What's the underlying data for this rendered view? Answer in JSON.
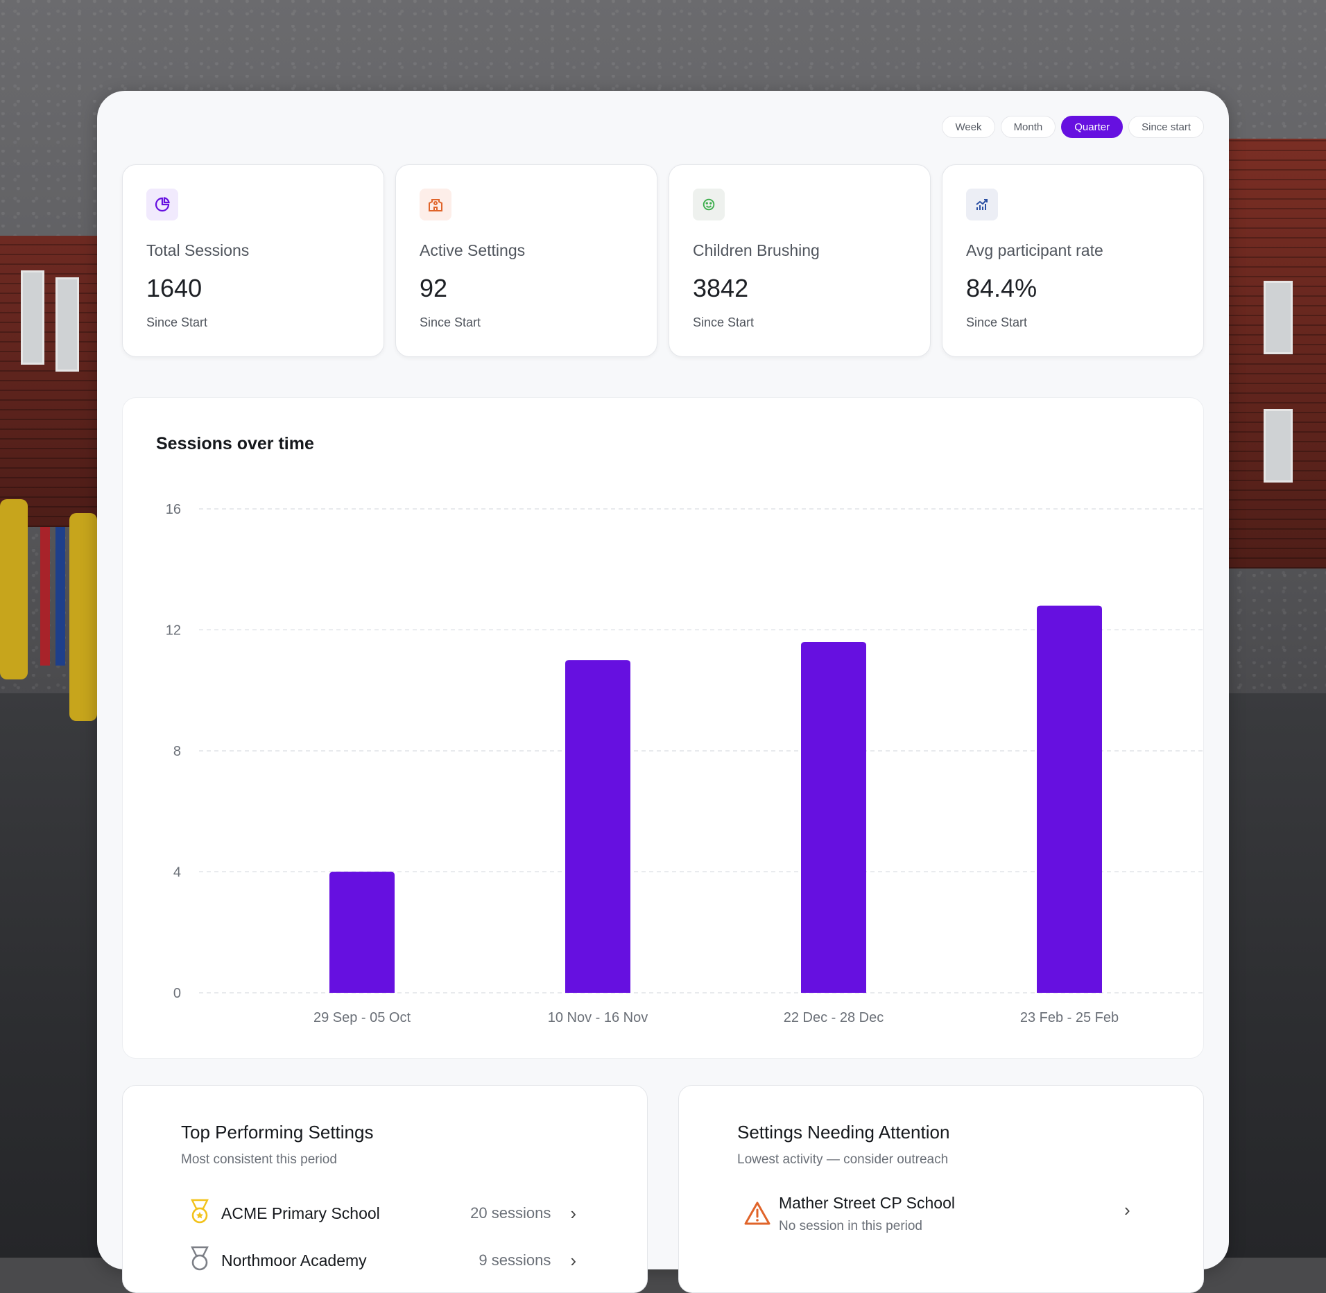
{
  "filters": {
    "options": [
      "Week",
      "Month",
      "Quarter",
      "Since start"
    ],
    "selected": "Quarter"
  },
  "stats": [
    {
      "icon": "pie-chart-icon",
      "label": "Total Sessions",
      "value": "1640",
      "sub": "Since Start",
      "icon_bg": "#f1eafd",
      "icon_color": "#6610e0"
    },
    {
      "icon": "school-building-icon",
      "label": "Active Settings",
      "value": "92",
      "sub": "Since Start",
      "icon_bg": "#fdeee9",
      "icon_color": "#e0642a"
    },
    {
      "icon": "smiley-face-icon",
      "label": "Children Brushing",
      "value": "3842",
      "sub": "Since Start",
      "icon_bg": "#eef1ee",
      "icon_color": "#3cae4c"
    },
    {
      "icon": "trend-chart-icon",
      "label": "Avg participant rate",
      "value": "84.4%",
      "sub": "Since Start",
      "icon_bg": "#eceef5",
      "icon_color": "#2a4fa3"
    }
  ],
  "chart": {
    "title": "Sessions over time"
  },
  "chart_data": {
    "type": "bar",
    "categories": [
      "29 Sep - 05 Oct",
      "10 Nov - 16 Nov",
      "22 Dec - 28 Dec",
      "23 Feb - 25 Feb"
    ],
    "values": [
      4,
      11,
      11.6,
      12.8
    ],
    "title": "Sessions over time",
    "xlabel": "",
    "ylabel": "",
    "ylim": [
      0,
      16
    ],
    "yticks": [
      0,
      4,
      8,
      12,
      16
    ],
    "grid": true,
    "bar_color": "#6610e0"
  },
  "top_settings": {
    "title": "Top Performing Settings",
    "subtitle": "Most consistent this period",
    "items": [
      {
        "name": "ACME Primary School",
        "count": "20 sessions",
        "icon": "gold-medal-icon"
      },
      {
        "name": "Northmoor Academy",
        "count": "9 sessions",
        "icon": "silver-medal-icon"
      }
    ]
  },
  "attention": {
    "title": "Settings Needing Attention",
    "subtitle": "Lowest activity — consider outreach",
    "items": [
      {
        "name": "Mather Street CP School",
        "status": "No session in this period",
        "icon": "warning-triangle-icon"
      }
    ]
  },
  "colors": {
    "accent": "#6610e0",
    "warning": "#e0642a",
    "medal_gold": "#f2c21b"
  }
}
